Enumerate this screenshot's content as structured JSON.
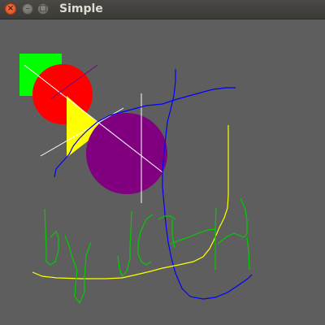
{
  "window": {
    "title": "Simple",
    "controls": {
      "close_glyph": "×",
      "minimize_glyph": "–",
      "maximize_glyph": "□"
    }
  },
  "colors": {
    "background": "#5e5e5e",
    "square": "#00ff00",
    "red_circle": "#ff0000",
    "triangle": "#ffff00",
    "purple_circle": "#800080",
    "white_lines": "#ffffff",
    "blue_stroke": "#0000ff",
    "yellow_stroke": "#ffff00",
    "green_stroke": "#00cc00",
    "purple_line": "#800080"
  }
}
